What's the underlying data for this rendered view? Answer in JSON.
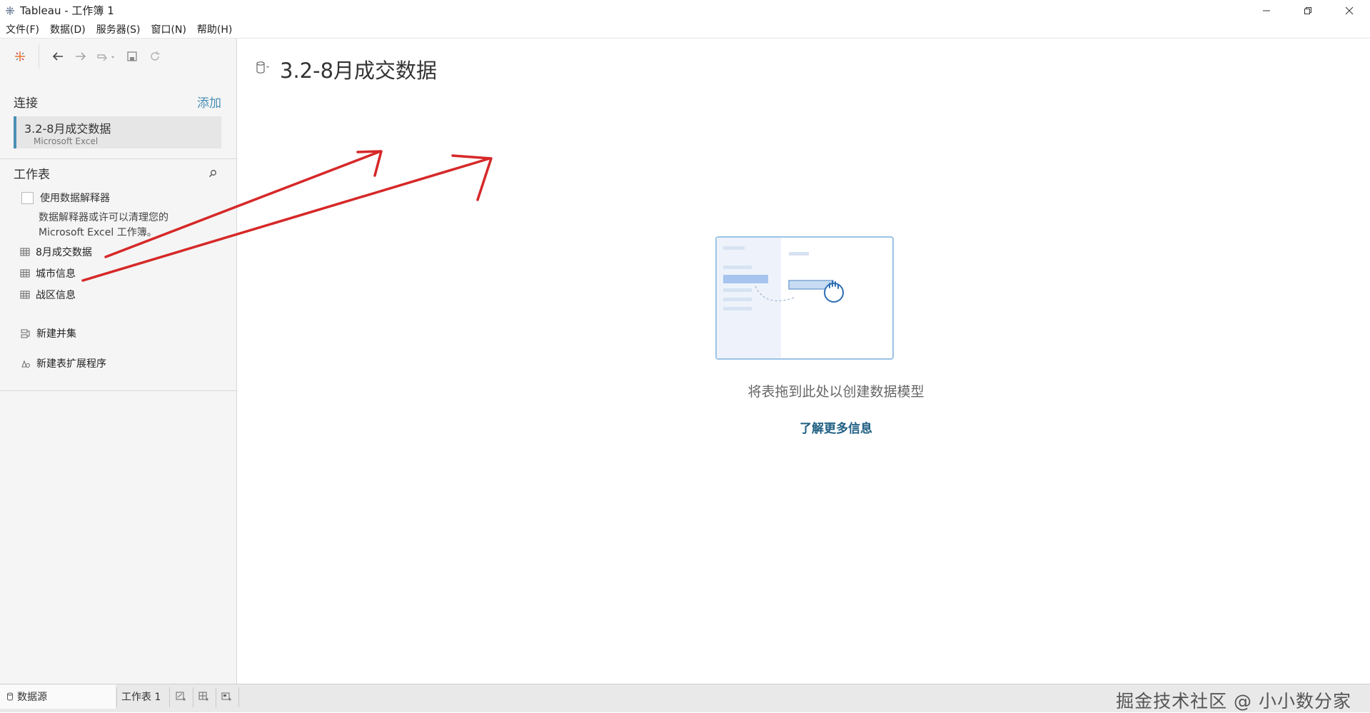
{
  "window": {
    "title": "Tableau - 工作簿 1",
    "controls": [
      "minimize",
      "restore",
      "close"
    ]
  },
  "menubar": {
    "items": [
      "文件(F)",
      "数据(D)",
      "服务器(S)",
      "窗口(N)",
      "帮助(H)"
    ]
  },
  "sidebar": {
    "connections": {
      "title": "连接",
      "add_label": "添加",
      "items": [
        {
          "name": "3.2-8月成交数据",
          "type": "Microsoft Excel"
        }
      ]
    },
    "sheets": {
      "title": "工作表",
      "interpreter": {
        "checkbox_label": "使用数据解释器",
        "checked": false,
        "description_line1": "数据解释器或许可以清理您的",
        "description_line2": "Microsoft Excel 工作簿。"
      },
      "items": [
        "8月成交数据",
        "城市信息",
        "战区信息"
      ]
    },
    "actions": {
      "new_union": "新建并集",
      "new_extension": "新建表扩展程序"
    }
  },
  "main": {
    "datasource_title": "3.2-8月成交数据",
    "drop_hint": "将表拖到此处以创建数据模型",
    "learn_more": "了解更多信息"
  },
  "bottombar": {
    "datasource_tab": "数据源",
    "sheet_tab": "工作表 1",
    "watermark": "掘金技术社区 @ 小小数分家"
  },
  "colors": {
    "accent": "#4a8fb5",
    "link_dark": "#1f5f83",
    "annotation_arrow": "#d62828"
  }
}
